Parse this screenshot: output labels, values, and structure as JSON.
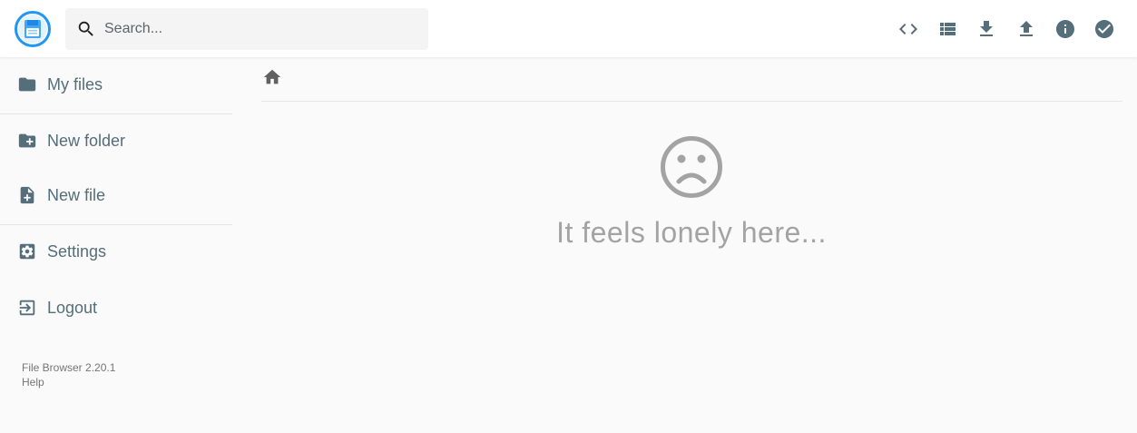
{
  "header": {
    "logo_alt": "File Browser",
    "search": {
      "placeholder": "Search..."
    },
    "actions": [
      {
        "icon": "code-icon",
        "title": "Toggle shell"
      },
      {
        "icon": "list-view-icon",
        "title": "Switch view"
      },
      {
        "icon": "download-icon",
        "title": "Download"
      },
      {
        "icon": "upload-icon",
        "title": "Upload"
      },
      {
        "icon": "info-icon",
        "title": "Info"
      },
      {
        "icon": "check-circle-icon",
        "title": "Select multiple"
      }
    ]
  },
  "sidebar": {
    "items": [
      {
        "label": "My files",
        "icon": "folder-icon"
      },
      {
        "label": "New folder",
        "icon": "create-new-folder-icon"
      },
      {
        "label": "New file",
        "icon": "note-add-icon"
      },
      {
        "label": "Settings",
        "icon": "settings-icon"
      },
      {
        "label": "Logout",
        "icon": "exit-to-app-icon"
      }
    ],
    "version": "File Browser 2.20.1",
    "help": "Help"
  },
  "breadcrumb": {
    "home_icon": "home-icon"
  },
  "main": {
    "empty_icon": "sad-face-icon",
    "empty_message": "It feels lonely here..."
  },
  "colors": {
    "accent": "#2196f3",
    "icon": "#546e7a",
    "empty_text": "#a3a3a3",
    "background": "#fafafa"
  }
}
